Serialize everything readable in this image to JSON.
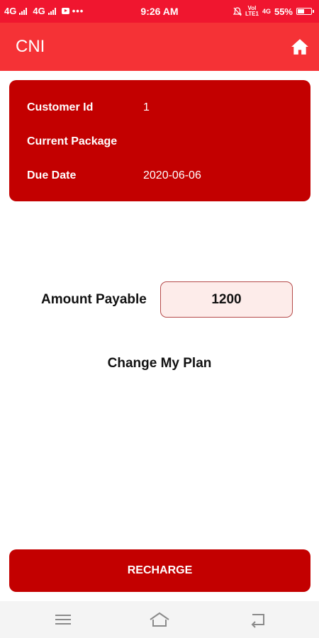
{
  "status_bar": {
    "network1": "4G",
    "network2": "4G",
    "more": "•••",
    "time": "9:26 AM",
    "volte_top": "Vol",
    "volte_bottom": "LTE1",
    "network3": "4G",
    "battery": "55%",
    "battery_level": 0.55,
    "icons": [
      "signal-icon",
      "signal-icon",
      "youtube-icon",
      "mute-icon",
      "battery-icon"
    ]
  },
  "app_bar": {
    "title": "CNI",
    "home_icon": "home-icon"
  },
  "info_card": {
    "rows": [
      {
        "label": "Customer Id",
        "value": "1"
      },
      {
        "label": "Current Package",
        "value": ""
      },
      {
        "label": "Due Date",
        "value": "2020-06-06"
      }
    ]
  },
  "amount": {
    "label": "Amount Payable",
    "value": "1200"
  },
  "change_plan": "Change My Plan",
  "recharge_label": "RECHARGE",
  "nav_bar": {
    "icons": [
      "menu-icon",
      "home-outline-icon",
      "back-icon"
    ]
  },
  "colors": {
    "status_bar": "#f0162f",
    "app_bar": "#f53236",
    "card": "#c30000",
    "amount_box_bg": "#fdecea",
    "amount_box_border": "#b54a4a"
  }
}
